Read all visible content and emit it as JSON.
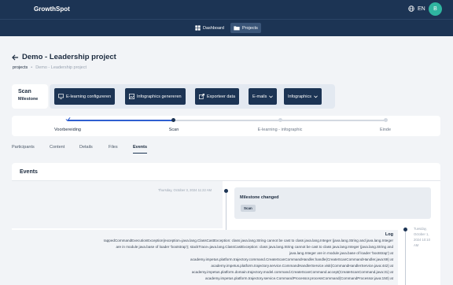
{
  "header": {
    "logo": "GrowthSpot",
    "language": "EN",
    "avatar_initial": "B"
  },
  "nav": {
    "dashboard": "Dashboard",
    "projects": "Projects"
  },
  "page": {
    "title": "Demo - Leadership project",
    "breadcrumb_root": "projects",
    "breadcrumb_sep": "•",
    "breadcrumb_current": "Demo - Leadership project"
  },
  "phase": {
    "title": "Scan",
    "subtitle": "Milestone"
  },
  "actions": {
    "elearning": "E-learning configureren",
    "infographics_gen": "Infographics genereren",
    "export": "Exporteer data",
    "emails": "E-mails",
    "infographics": "Infographics"
  },
  "steps": [
    {
      "label": "Voorbereiding",
      "state": "done"
    },
    {
      "label": "Scan",
      "state": "current"
    },
    {
      "label": "E-learning - infographic",
      "state": "todo"
    },
    {
      "label": "Einde",
      "state": "todo"
    }
  ],
  "tabs": [
    "Participants",
    "Content",
    "Details",
    "Files",
    "Events"
  ],
  "active_tab": "Events",
  "events": {
    "title": "Events",
    "item1_time": "Thursday, October 3, 2024 11:22 AM",
    "item1_title": "Milestone changed",
    "item1_tag": "Scan",
    "item2_time": "Tuesday, October 1, 2024 10:10 AM",
    "log_title": "Log",
    "log_lines": [
      "rappedCommandExecutionException{exception=java.lang.ClassCastException: class java.lang.String cannot be cast to class java.lang.Integer (java.lang.String and java.lang.Integer",
      "are in module java.base of loader 'bootstrap'); stackTrace=java.lang.ClassCastException: class java.lang.String cannot be cast to class java.lang.Integer (java.lang.String and",
      "java.lang.Integer are in module java.base of loader 'bootstrap') at",
      "academy.impetus.platform.trajectory.command.CreateScanCommandHandler.handle(CreateScanCommandHandler.java:69) at",
      "academy.impetus.platform.trajectory.service.CommandHandlerService.visit(CommandHandlerService.java:442) at",
      "academy.impetus.platform.domain.trajectory.model.command.CreateScanCommand.accept(CreateScanCommand.java:31) at",
      "academy.impetus.platform.trajectory.service.CommandProcessor.processCommand(CommandProcessor.java:150) at"
    ]
  },
  "colors": {
    "navy": "#1c3454",
    "teal": "#2fb5a0",
    "step_blue": "#2f5fd0"
  }
}
